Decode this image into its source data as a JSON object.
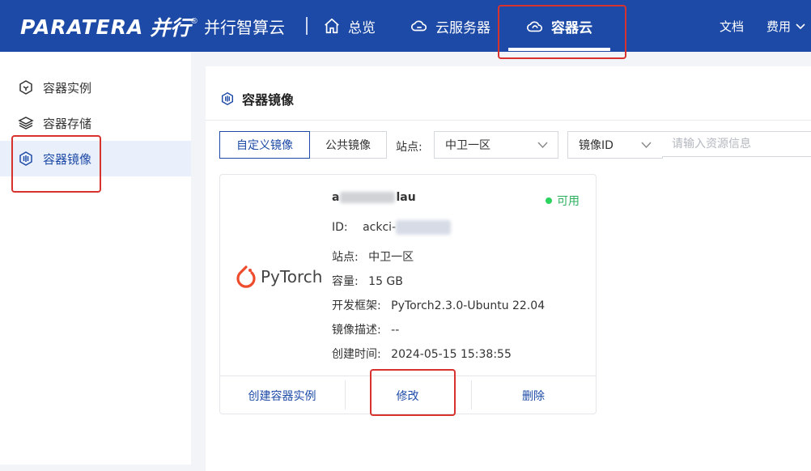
{
  "brand": {
    "logo_en": "PARATERA",
    "logo_cn": "并行",
    "reg": "®",
    "product": "并行智算云"
  },
  "nav": [
    {
      "label": "总览",
      "icon": "home-icon"
    },
    {
      "label": "云服务器",
      "icon": "cloud-server-icon"
    },
    {
      "label": "容器云",
      "icon": "container-cloud-icon",
      "active": true
    }
  ],
  "header_right": {
    "docs": "文档",
    "fee": "费用"
  },
  "sidebar": [
    {
      "label": "容器实例",
      "icon": "container-instance-icon"
    },
    {
      "label": "容器存储",
      "icon": "storage-layers-icon"
    },
    {
      "label": "容器镜像",
      "icon": "container-image-icon",
      "active": true
    }
  ],
  "main": {
    "title": "容器镜像",
    "tabs": [
      "自定义镜像",
      "公共镜像"
    ],
    "site_label": "站点:",
    "site_value": "中卫一区",
    "search_field": "镜像ID",
    "search_placeholder": "请输入资源信息"
  },
  "image_card": {
    "logo_text": "PyTorch",
    "name_prefix": "a",
    "name_suffix": "lau",
    "status": "可用",
    "id_label": "ID:",
    "id_value": "ackci-",
    "site_label": "站点:",
    "site_value": "中卫一区",
    "capacity_label": "容量:",
    "capacity_value": "15 GB",
    "framework_label": "开发框架:",
    "framework_value": "PyTorch2.3.0-Ubuntu 22.04",
    "desc_label": "镜像描述:",
    "desc_value": "--",
    "created_label": "创建时间:",
    "created_value": "2024-05-15 15:38:55",
    "actions": {
      "create": "创建容器实例",
      "edit": "修改",
      "delete": "删除"
    }
  },
  "colors": {
    "header": "#1d4aa6",
    "accent": "#1d4aa6",
    "status_green": "#2bb05c",
    "highlight": "#d8322e"
  }
}
